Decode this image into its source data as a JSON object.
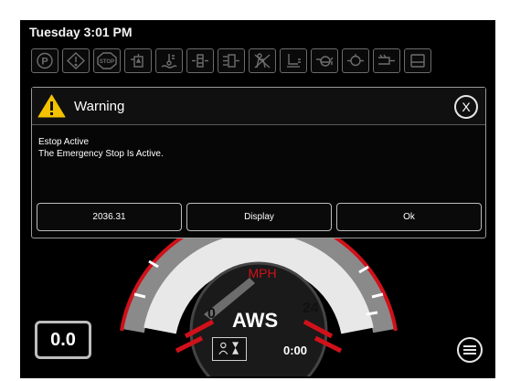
{
  "status_bar": {
    "datetime": "Tuesday 3:01 PM"
  },
  "indicator_icons": [
    {
      "name": "parking-brake-icon",
      "label": "P"
    },
    {
      "name": "warning-diamond-icon"
    },
    {
      "name": "stop-icon",
      "label": "STOP"
    },
    {
      "name": "transmission-fluid-icon"
    },
    {
      "name": "coolant-temp-icon"
    },
    {
      "name": "fuel-filter-icon"
    },
    {
      "name": "air-filter-icon"
    },
    {
      "name": "seatbelt-off-icon"
    },
    {
      "name": "engine-oil-level-icon"
    },
    {
      "name": "oil-pressure-icon"
    },
    {
      "name": "hydraulic-icon"
    },
    {
      "name": "glow-plug-icon"
    },
    {
      "name": "fuel-tank-icon"
    }
  ],
  "dialog": {
    "title": "Warning",
    "close_label": "X",
    "message_line1": "Estop Active",
    "message_line2": "The Emergency Stop Is Active.",
    "buttons": [
      "2036.31",
      "Display",
      "Ok"
    ]
  },
  "gauge": {
    "unit": "MPH",
    "min_label": "0",
    "max_label": "24",
    "value": 0,
    "colors": {
      "accent": "#d0111a",
      "face": "#e8e8e8",
      "needle": "#6d6d6d"
    }
  },
  "speed_readout": "0.0",
  "mode_label": "AWS",
  "timer": "0:00",
  "icons": {
    "menu": "menu-icon",
    "timer": "hourglass-timer-icon",
    "close": "close-icon",
    "warning": "warning-triangle-icon"
  }
}
